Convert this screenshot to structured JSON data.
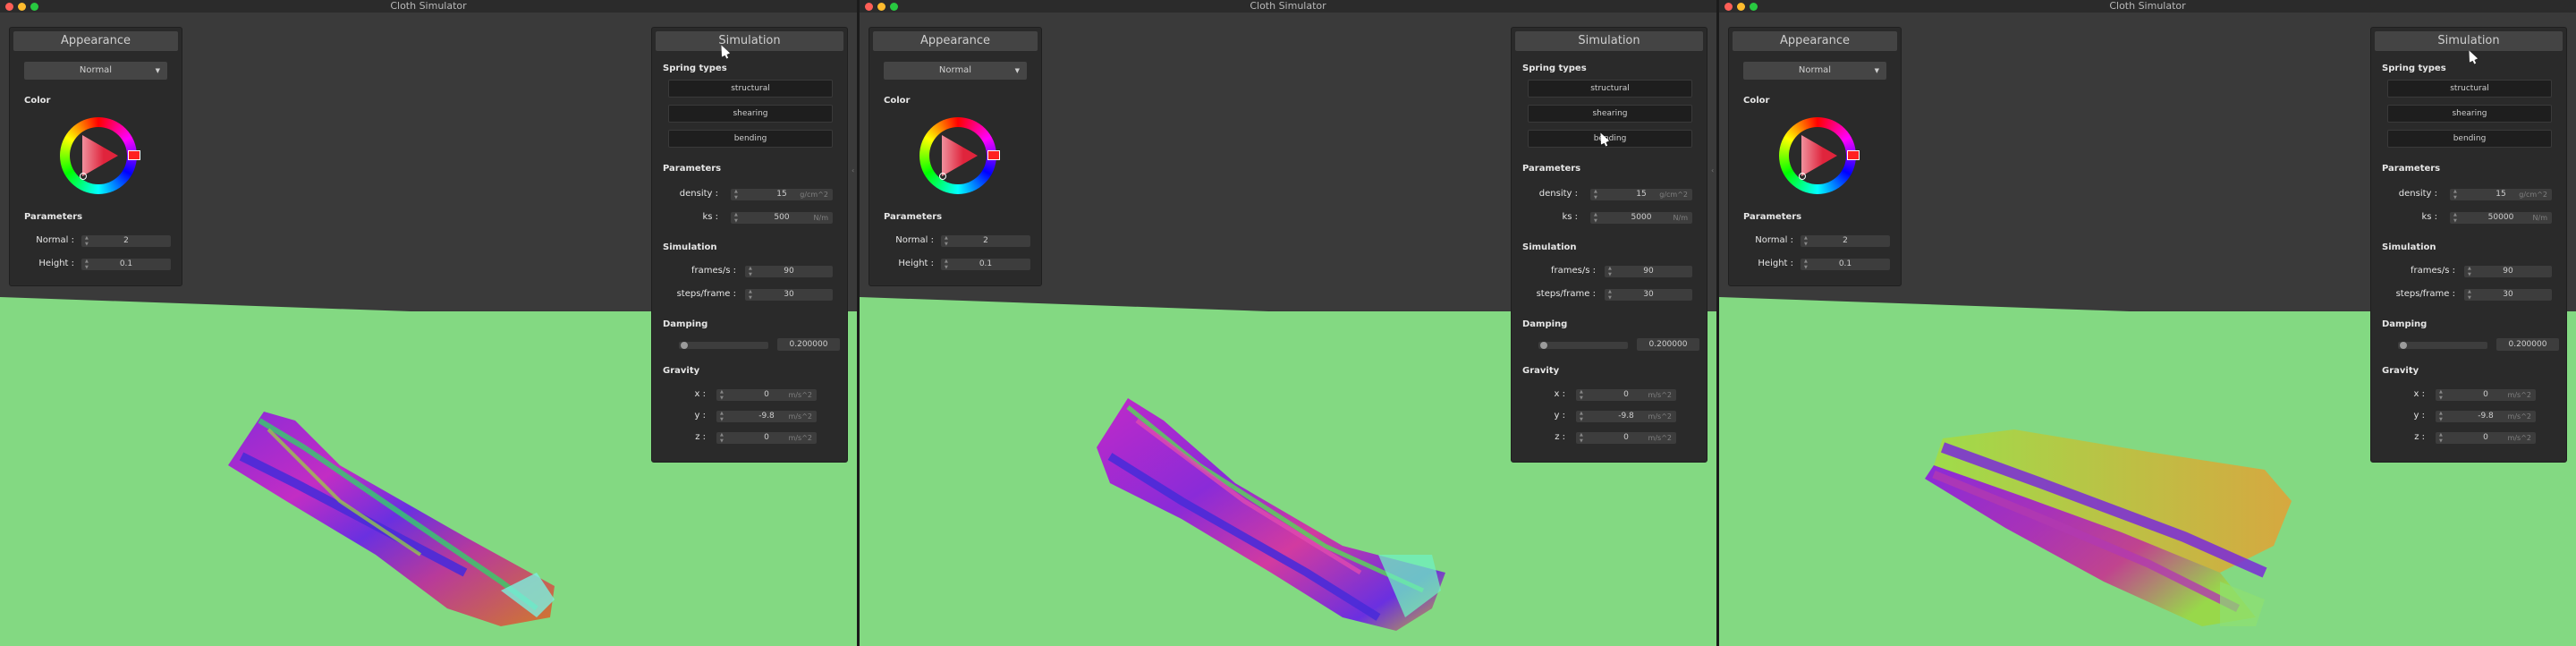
{
  "window_title": "Cloth Simulator",
  "appearance": {
    "title": "Appearance",
    "shading_mode": "Normal",
    "color_label": "Color",
    "parameters_label": "Parameters",
    "normal_label": "Normal :",
    "height_label": "Height :",
    "normal_value": "2",
    "height_value": "0.1"
  },
  "simulation": {
    "title": "Simulation",
    "spring_types_label": "Spring types",
    "spring_types": [
      "structural",
      "shearing",
      "bending"
    ],
    "parameters_label": "Parameters",
    "density_label": "density :",
    "density_unit": "g/cm^2",
    "density_value": "15",
    "ks_label": "ks :",
    "ks_unit": "N/m",
    "simulation_label": "Simulation",
    "fps_label": "frames/s :",
    "fps_value": "90",
    "steps_label": "steps/frame :",
    "steps_value": "30",
    "damping_label": "Damping",
    "damping_value": "0.200000",
    "damping_level": 0.2,
    "gravity_label": "Gravity",
    "gx_label": "x :",
    "gy_label": "y :",
    "gz_label": "z :",
    "gx_value": "0",
    "gy_value": "-9.8",
    "gz_value": "0",
    "gravity_unit": "m/s^2"
  },
  "windows": [
    {
      "ks_value": "500"
    },
    {
      "ks_value": "5000"
    },
    {
      "ks_value": "50000"
    }
  ],
  "colors": {
    "floor": "#83d982",
    "background": "#3a3a3a",
    "panel": "#2a2a2a"
  }
}
